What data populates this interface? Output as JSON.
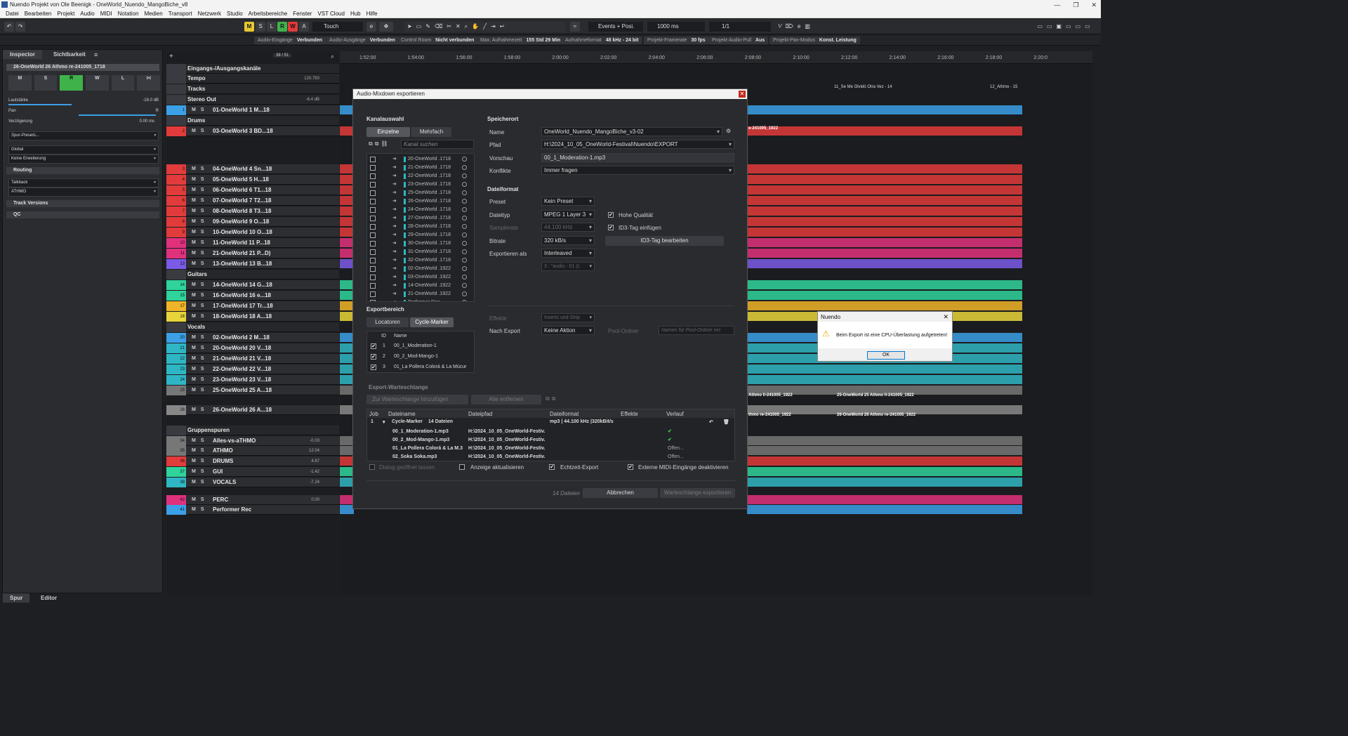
{
  "window": {
    "title": "Nuendo Projekt von Ole Beenigk - OneWorld_Nuendo_MangoBiche_v8"
  },
  "menu": [
    "Datei",
    "Bearbeiten",
    "Projekt",
    "Audio",
    "MIDI",
    "Notation",
    "Medien",
    "Transport",
    "Netzwerk",
    "Studio",
    "Arbeitsbereiche",
    "Fenster",
    "VST Cloud",
    "Hub",
    "Hilfe"
  ],
  "toolbar": {
    "m": "M",
    "s": "S",
    "l": "L",
    "r": "R",
    "w": "W",
    "a": "A",
    "automation_mode": "Touch",
    "events_mode": "Events + Posi.",
    "nudge": "1000 ms",
    "quantize": "1/1"
  },
  "statusbar": [
    {
      "label": "Audio-Eingänge",
      "value": "Verbunden"
    },
    {
      "label": "Audio-Ausgänge",
      "value": "Verbunden"
    },
    {
      "label": "Control Room",
      "value": "Nicht verbunden"
    },
    {
      "label": "Max. Aufnahmezeit",
      "value": "155 Std 29 Min"
    },
    {
      "label": "Aufnahmeformat",
      "value": "48 kHz - 24 bit"
    },
    {
      "label": "Projekt-Framerate",
      "value": "30 fps"
    },
    {
      "label": "Projekt-Audio-Pull",
      "value": "Aus"
    },
    {
      "label": "Projekt-Pan-Modus",
      "value": "Konst. Leistung"
    }
  ],
  "inspector": {
    "tab1": "Inspector",
    "tab2": "Sichtbarkeit",
    "track_name": "26-OneWorld 26 Athmo re-241005_1718",
    "volume_label": "Lautstärke",
    "volume_value": "-16.0 dB",
    "pan_label": "Pan",
    "pan_r": "R",
    "delay_label": "Verzögerung",
    "delay_value": "0.00 ms",
    "presets": "Spur-Presets...",
    "global": "Global",
    "ext": "Keine Erweiterung",
    "routing": "Routing",
    "talkback": "Talkback",
    "athmo": "ATHMO",
    "track_versions": "Track Versions",
    "qc": "QC",
    "bottom_tab1": "Spur",
    "bottom_tab2": "Editor"
  },
  "tracklist": {
    "counter": "38 / 51",
    "rows": [
      {
        "num": "",
        "name": "Eingangs-/Ausgangskanäle",
        "color": "#3a3b40"
      },
      {
        "num": "",
        "name": "Tempo",
        "color": "#3a3b40",
        "extra": "120.750"
      },
      {
        "num": "",
        "name": "Tracks",
        "color": "#3a3b40"
      },
      {
        "num": "",
        "name": "Stereo Out",
        "color": "#3a3b40",
        "extra": "-6.4 dB"
      },
      {
        "num": "1",
        "name": "01-OneWorld 1 M...18",
        "color": "#3ba0e6"
      },
      {
        "num": "",
        "name": "Drums",
        "color": "#3a3b40"
      },
      {
        "num": "2",
        "name": "03-OneWorld 3 BD...18",
        "color": "#e23b3b"
      },
      {
        "num": "3",
        "name": "04-OneWorld 4 Sn...18",
        "color": "#e23b3b"
      },
      {
        "num": "4",
        "name": "05-OneWorld 5 H...18",
        "color": "#e23b3b"
      },
      {
        "num": "5",
        "name": "06-OneWorld 6 T1...18",
        "color": "#e23b3b"
      },
      {
        "num": "6",
        "name": "07-OneWorld 7 T2...18",
        "color": "#e23b3b"
      },
      {
        "num": "7",
        "name": "08-OneWorld 8 T3...18",
        "color": "#e23b3b"
      },
      {
        "num": "8",
        "name": "09-OneWorld 9 O...18",
        "color": "#e23b3b"
      },
      {
        "num": "9",
        "name": "10-OneWorld 10 O...18",
        "color": "#e23b3b"
      },
      {
        "num": "10",
        "name": "11-OneWorld 11 P...18",
        "color": "#e0317d"
      },
      {
        "num": "11",
        "name": "21-OneWorld 21 P...D)",
        "color": "#e0317d"
      },
      {
        "num": "13",
        "name": "13-OneWorld 13 B...18",
        "color": "#7a5ae6"
      },
      {
        "num": "",
        "name": "Guitars",
        "color": "#3a3b40"
      },
      {
        "num": "14",
        "name": "14-OneWorld 14 G...18",
        "color": "#2fd39b"
      },
      {
        "num": "15",
        "name": "16-OneWorld 16 e...18",
        "color": "#2fd39b"
      },
      {
        "num": "17",
        "name": "17-OneWorld 17 Tr...18",
        "color": "#f0b429"
      },
      {
        "num": "18",
        "name": "18-OneWorld 18 A...18",
        "color": "#e8d53a"
      },
      {
        "num": "",
        "name": "Vocals",
        "color": "#3a3b40"
      },
      {
        "num": "20",
        "name": "02-OneWorld 2 M...18",
        "color": "#3ba0e6"
      },
      {
        "num": "21",
        "name": "20-OneWorld 20 V...18",
        "color": "#2fb6c4"
      },
      {
        "num": "22",
        "name": "21-OneWorld 21 V...18",
        "color": "#2fb6c4"
      },
      {
        "num": "23",
        "name": "22-OneWorld 22 V...18",
        "color": "#2fb6c4"
      },
      {
        "num": "24",
        "name": "23-OneWorld 23 V...18",
        "color": "#2fb6c4"
      },
      {
        "num": "25",
        "name": "25-OneWorld 25 A...18",
        "color": "#777"
      },
      {
        "num": "26",
        "name": "26-OneWorld 26 A...18",
        "color": "#888"
      },
      {
        "num": "",
        "name": "Gruppenspuren",
        "color": "#3a3b40"
      },
      {
        "num": "34",
        "name": "Alles-vs-aTHMO",
        "color": "#777",
        "extra": "-0.03"
      },
      {
        "num": "35",
        "name": "ATHMO",
        "color": "#777",
        "extra": "12.04"
      },
      {
        "num": "36",
        "name": "DRUMS",
        "color": "#e23b3b",
        "extra": "4.87"
      },
      {
        "num": "37",
        "name": "GUI",
        "color": "#2fd39b",
        "extra": "-1.42"
      },
      {
        "num": "38",
        "name": "VOCALS",
        "color": "#2fb6c4",
        "extra": "-7.24"
      },
      {
        "num": "42",
        "name": "PERC",
        "color": "#e0317d",
        "extra": "0.00"
      },
      {
        "num": "41",
        "name": "Performer Rec",
        "color": "#3ba0e6"
      }
    ]
  },
  "ruler": [
    "1:52:00",
    "1:54:00",
    "1:56:00",
    "1:58:00",
    "2:00:00",
    "2:02:00",
    "2:04:00",
    "2:06:00",
    "2:08:00",
    "2:10:00",
    "2:12:00",
    "2:14:00",
    "2:16:00",
    "2:18:00",
    "2:20:0"
  ],
  "dialog": {
    "title": "Audio-Mixdown exportieren",
    "kanalauswahl": "Kanalauswahl",
    "einzelne": "Einzelne",
    "mehrfach": "Mehrfach",
    "search_placeholder": "Kanal suchen",
    "channels": [
      "20-OneWorld .1718",
      "21-OneWorld .1718",
      "22-OneWorld .1718",
      "23-OneWorld .1718",
      "25-OneWorld .1718",
      "26-OneWorld .1718",
      "24-OneWorld .1718",
      "27-OneWorld .1718",
      "28-OneWorld .1718",
      "29-OneWorld .1718",
      "30-OneWorld .1718",
      "31-OneWorld .1718",
      "32-OneWorld .1718",
      "02-OneWorld .1922",
      "03-OneWorld .1922",
      "14-OneWorld .1922",
      "21-OneWorld .1922",
      "Performer Rec"
    ],
    "exportbereich": "Exportbereich",
    "locatoren": "Locatoren",
    "cycle_marker": "Cycle-Marker",
    "marker_head_id": "ID",
    "marker_head_name": "Name",
    "markers": [
      {
        "id": "1",
        "name": "00_1_Moderation-1"
      },
      {
        "id": "2",
        "name": "00_2_Mod-Mango-1"
      },
      {
        "id": "3",
        "name": "01_La Pollera Colorá & La Múcur"
      }
    ],
    "speicherort": "Speicherort",
    "name_label": "Name",
    "name_value": "OneWorld_Nuendo_MangoBiche_v3-02",
    "pfad_label": "Pfad",
    "pfad_value": "H:\\2024_10_05_OneWorld-Festival\\Nuendo\\EXPORT",
    "vorschau_label": "Vorschau",
    "vorschau_value": "00_1_Moderation-1.mp3",
    "konflikte_label": "Konflikte",
    "konflikte_value": "Immer fragen",
    "dateiformat": "Dateiformat",
    "preset_label": "Preset",
    "preset_value": "Kein Preset",
    "dateityp_label": "Dateityp",
    "dateityp_value": "MPEG 1 Layer 3",
    "samplerate_label": "Samplerate",
    "samplerate_value": "44.100 kHz",
    "bitrate_label": "Bitrate",
    "bitrate_value": "320 kB/s",
    "exportieren_als_label": "Exportieren als",
    "exportieren_als_value": "Interleaved",
    "audio_value": "3 : \"audio - 01 (L",
    "hohe_qualitaet": "Hohe Qualität",
    "id3_einfuegen": "ID3-Tag einfügen",
    "id3_bearbeiten": "ID3-Tag bearbeiten",
    "effekte_label": "Effekte",
    "effekte_value": "Inserts und Strip",
    "nach_export_label": "Nach Export",
    "nach_export_value": "Keine Aktion",
    "pool_label": "Pool-Ordner",
    "pool_placeholder": "Namen für Pool-Ordner ein",
    "queue_title": "Export-Warteschlange",
    "queue_add": "Zur Warteschlange hinzufügen",
    "queue_remove": "Alle entfernen",
    "queue_cols": [
      "Job",
      "Dateiname",
      "Dateipfad",
      "Dateiformat",
      "Effekte",
      "Verlauf"
    ],
    "queue_job": {
      "job": "1",
      "name": "Cycle-Marker",
      "count": "14 Dateien",
      "format": "mp3 | 44.100 kHz |320kBit/s"
    },
    "queue_files": [
      {
        "name": "00_1_Moderation-1.mp3",
        "path": "H:\\2024_10_05_OneWorld-Festiv.",
        "status": "✔"
      },
      {
        "name": "00_2_Mod-Mango-1.mp3",
        "path": "H:\\2024_10_05_OneWorld-Festiv.",
        "status": "✔"
      },
      {
        "name": "01_La Pollera Colorá & La M.3",
        "path": "H:\\2024_10_05_OneWorld-Festiv.",
        "status": "Offen..."
      },
      {
        "name": "02_Soka Soka.mp3",
        "path": "H:\\2024_10_05_OneWorld-Festiv.",
        "status": "Offen..."
      }
    ],
    "dialog_open": "Dialog geöffnet lassen",
    "anzeige": "Anzeige aktualisieren",
    "echtzeit": "Echtzeit-Export",
    "midi": "Externe MIDI-Eingänge deaktivieren",
    "file_count": "14 Dateien",
    "abbrechen": "Abbrechen",
    "export_btn": "Warteschlange exportieren"
  },
  "popup": {
    "title": "Nuendo",
    "message": "Beim Export ist eine CPU-Überlastung aufgetreten!",
    "ok": "OK"
  },
  "events": {
    "e1": "11_Se Me Olvidó Otra Vez - 14",
    "e2": "12_Athmo - 15",
    "e3": "e-241005_1922",
    "e4": "Athmo li-241005_1922",
    "e5": "25-OneWorld 25 Athmo li-241005_1922",
    "e6": "thmo re-241005_1922",
    "e7": "26-OneWorld 26 Athmo re-241005_1922"
  }
}
